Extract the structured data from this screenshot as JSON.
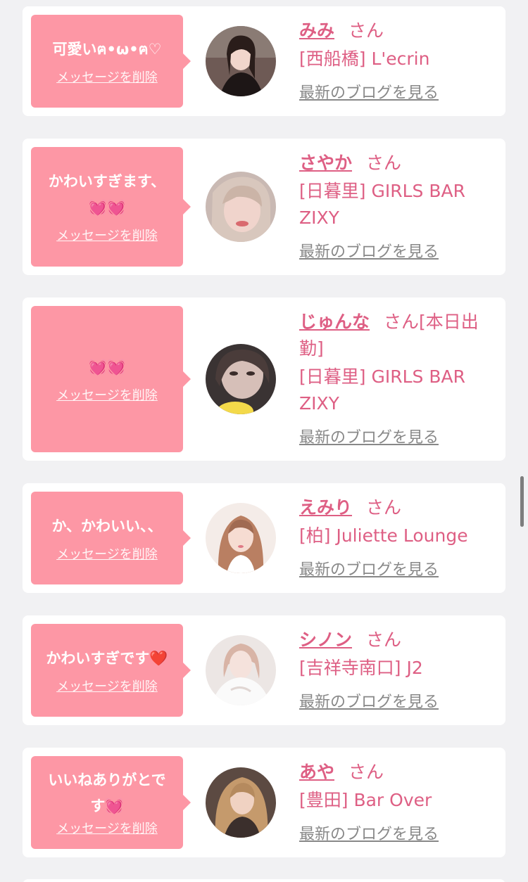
{
  "delete_label": "メッセージを削除",
  "san_label": "さん",
  "blog_label": "最新のブログを見る",
  "colors": {
    "bubble": "#fd97a5",
    "accent": "#de5f84",
    "link_gray": "#888888",
    "background": "#f1f1f3"
  },
  "messages": [
    {
      "message": "可愛いฅ•ω•ฅ♡",
      "name": "みみ",
      "name_suffix": "",
      "shop": "[西船橋] L'ecrin",
      "avatar_icon": "profile-photo"
    },
    {
      "message": "かわいすぎます、\n💓💓",
      "name": "さやか",
      "name_suffix": "",
      "shop": "[日暮里] GIRLS BAR ZIXY",
      "avatar_icon": "profile-photo"
    },
    {
      "message": "💓💓",
      "name": "じゅんな",
      "name_suffix": "[本日出勤]",
      "shop": "[日暮里] GIRLS BAR ZIXY",
      "avatar_icon": "profile-photo"
    },
    {
      "message": "か、かわいい、、",
      "name": "えみり",
      "name_suffix": "",
      "shop": "[柏] Juliette Lounge",
      "avatar_icon": "profile-photo"
    },
    {
      "message": "かわいすぎです❤️",
      "name": "シノン",
      "name_suffix": "",
      "shop": "[吉祥寺南口] J2",
      "avatar_icon": "profile-photo"
    },
    {
      "message": "いいねありがとで\nす💓",
      "name": "あや",
      "name_suffix": "",
      "shop": "[豊田] Bar Over",
      "avatar_icon": "profile-photo"
    }
  ]
}
